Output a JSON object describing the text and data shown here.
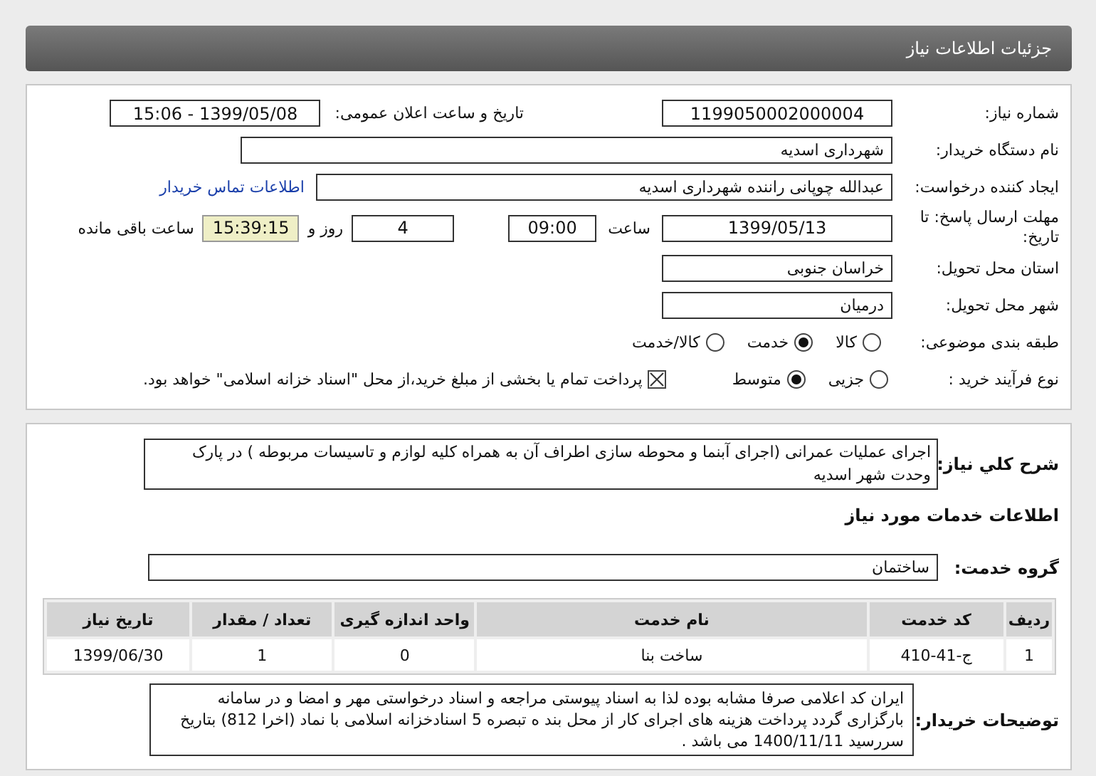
{
  "header": {
    "title": "جزئیات اطلاعات نیاز"
  },
  "need_number": {
    "label": "شماره نیاز:",
    "value": "1199050002000004"
  },
  "announce": {
    "label": "تاریخ و ساعت اعلان عمومی:",
    "value": "1399/05/08 - 15:06"
  },
  "buyer_org": {
    "label": "نام دستگاه خریدار:",
    "value": "شهرداری اسدیه"
  },
  "requester": {
    "label": "ایجاد کننده درخواست:",
    "value": "عبدالله چوپانی راننده شهرداری اسدیه",
    "contact_link": "اطلاعات تماس خریدار"
  },
  "deadline": {
    "label": "مهلت ارسال پاسخ: تا تاریخ:",
    "date": "1399/05/13",
    "time_label": "ساعت",
    "time": "09:00",
    "days": "4",
    "days_label": "روز و",
    "remaining": "15:39:15",
    "remaining_label": "ساعت باقی مانده"
  },
  "province": {
    "label": "استان محل تحویل:",
    "value": "خراسان جنوبی"
  },
  "city": {
    "label": "شهر محل تحویل:",
    "value": "درمیان"
  },
  "category": {
    "label": "طبقه بندی موضوعی:",
    "options": [
      {
        "label": "کالا",
        "selected": false
      },
      {
        "label": "خدمت",
        "selected": true
      },
      {
        "label": "کالا/خدمت",
        "selected": false
      }
    ]
  },
  "process": {
    "label": "نوع فرآیند خرید :",
    "options": [
      {
        "label": "جزیی",
        "selected": false
      },
      {
        "label": "متوسط",
        "selected": true
      }
    ],
    "payment": {
      "label": "پرداخت تمام یا بخشی از مبلغ خرید،از محل \"اسناد خزانه اسلامی\" خواهد بود.",
      "checked": true
    }
  },
  "description": {
    "label": "شرح کلي نياز:",
    "value": "اجرای عملیات عمرانی (اجرای آبنما و محوطه سازی اطراف آن به همراه کلیه لوازم و تاسیسات مربوطه ) در پارک وحدت شهر اسدیه"
  },
  "services_title": "اطلاعات خدمات مورد نیاز",
  "service_group": {
    "label": "گروه خدمت:",
    "value": "ساختمان"
  },
  "table": {
    "columns": [
      "ردیف",
      "کد خدمت",
      "نام خدمت",
      "واحد اندازه گیری",
      "تعداد / مقدار",
      "تاریخ نیاز"
    ],
    "rows": [
      [
        "1",
        "ج-41-410",
        "ساخت بنا",
        "0",
        "1",
        "1399/06/30"
      ]
    ]
  },
  "buyer_notes": {
    "label": "توضیحات خریدار:",
    "value": "ایران کد اعلامی صرفا  مشابه بوده لذا به اسناد پیوستی مراجعه و اسناد درخواستی مهر و امضا و در سامانه بارگزاری گردد  پرداخت هزینه های اجرای کار از محل بند ه تبصره 5 اسنادخزانه  اسلامی  با نماد (اخرا 812) بتاریخ سررسید  1400/11/11 می باشد ."
  }
}
